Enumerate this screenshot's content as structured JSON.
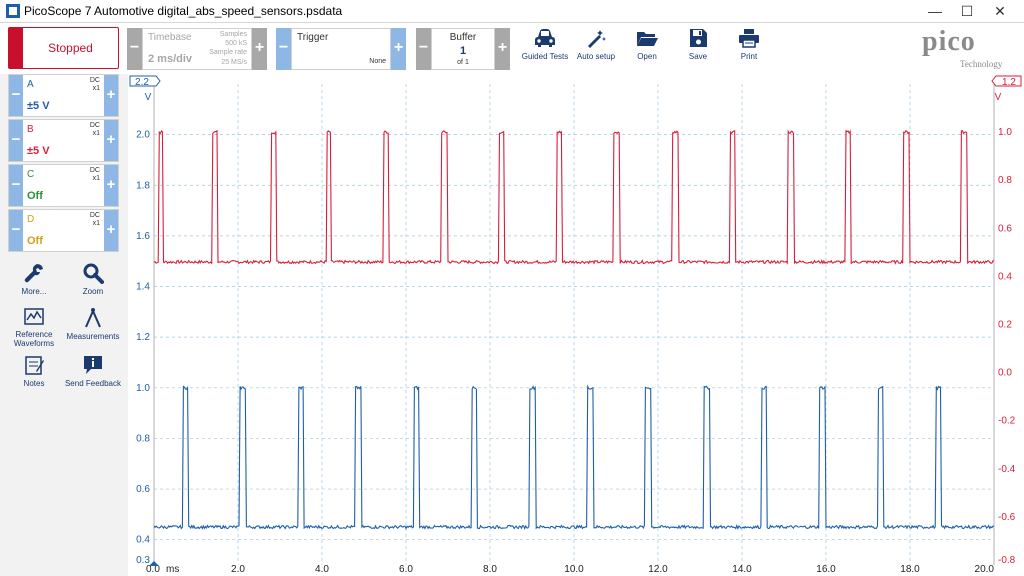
{
  "window": {
    "title": "PicoScope 7 Automotive digital_abs_speed_sensors.psdata",
    "minimize": "—",
    "maximize": "☐",
    "close": "✕"
  },
  "toolbar": {
    "run_state": "Stopped",
    "timebase_label": "Timebase",
    "timebase_value": "2 ms/div",
    "samples_label": "Samples",
    "samples_value": "500 kS",
    "sample_rate_label": "Sample rate",
    "sample_rate_value": "25 MS/s",
    "trigger_label": "Trigger",
    "trigger_value": "None",
    "buffer_label": "Buffer",
    "buffer_value": "1",
    "buffer_of": "of 1",
    "tools": [
      {
        "label": "Guided Tests",
        "icon": "car-icon"
      },
      {
        "label": "Auto setup",
        "icon": "magic-wand-icon"
      },
      {
        "label": "Open",
        "icon": "folder-icon"
      },
      {
        "label": "Save",
        "icon": "floppy-icon"
      },
      {
        "label": "Print",
        "icon": "printer-icon"
      }
    ],
    "logo": "pico",
    "logo_sub": "Technology"
  },
  "channels": [
    {
      "name": "A",
      "coupling": "DC",
      "probe": "x1",
      "range": "±5 V",
      "color": "#1f5fa8"
    },
    {
      "name": "B",
      "coupling": "DC",
      "probe": "x1",
      "range": "±5 V",
      "color": "#d81e3a"
    },
    {
      "name": "C",
      "coupling": "DC",
      "probe": "x1",
      "range": "Off",
      "color": "#2a8f3a"
    },
    {
      "name": "D",
      "coupling": "DC",
      "probe": "x1",
      "range": "Off",
      "color": "#d4a017"
    }
  ],
  "sidebar_tools": [
    {
      "label": "More...",
      "icon": "wrench-icon"
    },
    {
      "label": "Zoom",
      "icon": "magnifier-icon"
    },
    {
      "label": "Reference Waveforms",
      "icon": "waveform-icon"
    },
    {
      "label": "Measurements",
      "icon": "compass-icon"
    },
    {
      "label": "Notes",
      "icon": "notes-icon"
    },
    {
      "label": "Send Feedback",
      "icon": "feedback-icon"
    }
  ],
  "chart_data": {
    "type": "line",
    "x_unit": "ms",
    "xlim": [
      0,
      20
    ],
    "x_ticks": [
      "0.0",
      "2.0",
      "4.0",
      "6.0",
      "8.0",
      "10.0",
      "12.0",
      "14.0",
      "16.0",
      "18.0",
      "20.0"
    ],
    "left_axis": {
      "unit": "V",
      "top_label": "2.2",
      "bottom_label": "0.3",
      "ticks": [
        "2.0",
        "1.8",
        "1.6",
        "1.4",
        "1.2",
        "1.0",
        "0.8",
        "0.6",
        "0.4"
      ],
      "ylim": [
        0.3,
        2.2
      ]
    },
    "right_axis": {
      "unit": "V",
      "top_label": "1.2",
      "bottom_label": "-0.8",
      "ticks": [
        "1.0",
        "0.8",
        "0.6",
        "0.4",
        "0.2",
        "0.0",
        "-0.2",
        "-0.4",
        "-0.6"
      ],
      "ylim": [
        -0.8,
        1.2
      ]
    },
    "grid": true,
    "series": [
      {
        "name": "B",
        "axis": "right",
        "color": "#d81e3a",
        "low": 0.46,
        "high": 1.0,
        "pulses": [
          [
            0.12,
            0.2
          ],
          [
            1.38,
            1.52
          ],
          [
            2.78,
            2.92
          ],
          [
            4.1,
            4.22
          ],
          [
            5.46,
            5.6
          ],
          [
            6.85,
            6.98
          ],
          [
            8.21,
            8.35
          ],
          [
            9.58,
            9.71
          ],
          [
            10.95,
            11.1
          ],
          [
            12.35,
            12.48
          ],
          [
            13.71,
            13.85
          ],
          [
            15.1,
            15.23
          ],
          [
            16.47,
            16.6
          ],
          [
            17.84,
            17.98
          ],
          [
            19.21,
            19.35
          ]
        ]
      },
      {
        "name": "A",
        "axis": "left",
        "color": "#1f5fa8",
        "low": 0.45,
        "high": 1.0,
        "pulses": [
          [
            0.68,
            0.82
          ],
          [
            2.04,
            2.18
          ],
          [
            3.43,
            3.56
          ],
          [
            4.8,
            4.94
          ],
          [
            6.18,
            6.31
          ],
          [
            7.56,
            7.7
          ],
          [
            8.94,
            9.08
          ],
          [
            10.32,
            10.46
          ],
          [
            11.7,
            11.84
          ],
          [
            13.09,
            13.23
          ],
          [
            14.46,
            14.6
          ],
          [
            15.85,
            15.99
          ],
          [
            17.23,
            17.37
          ],
          [
            18.61,
            18.75
          ]
        ]
      }
    ]
  }
}
